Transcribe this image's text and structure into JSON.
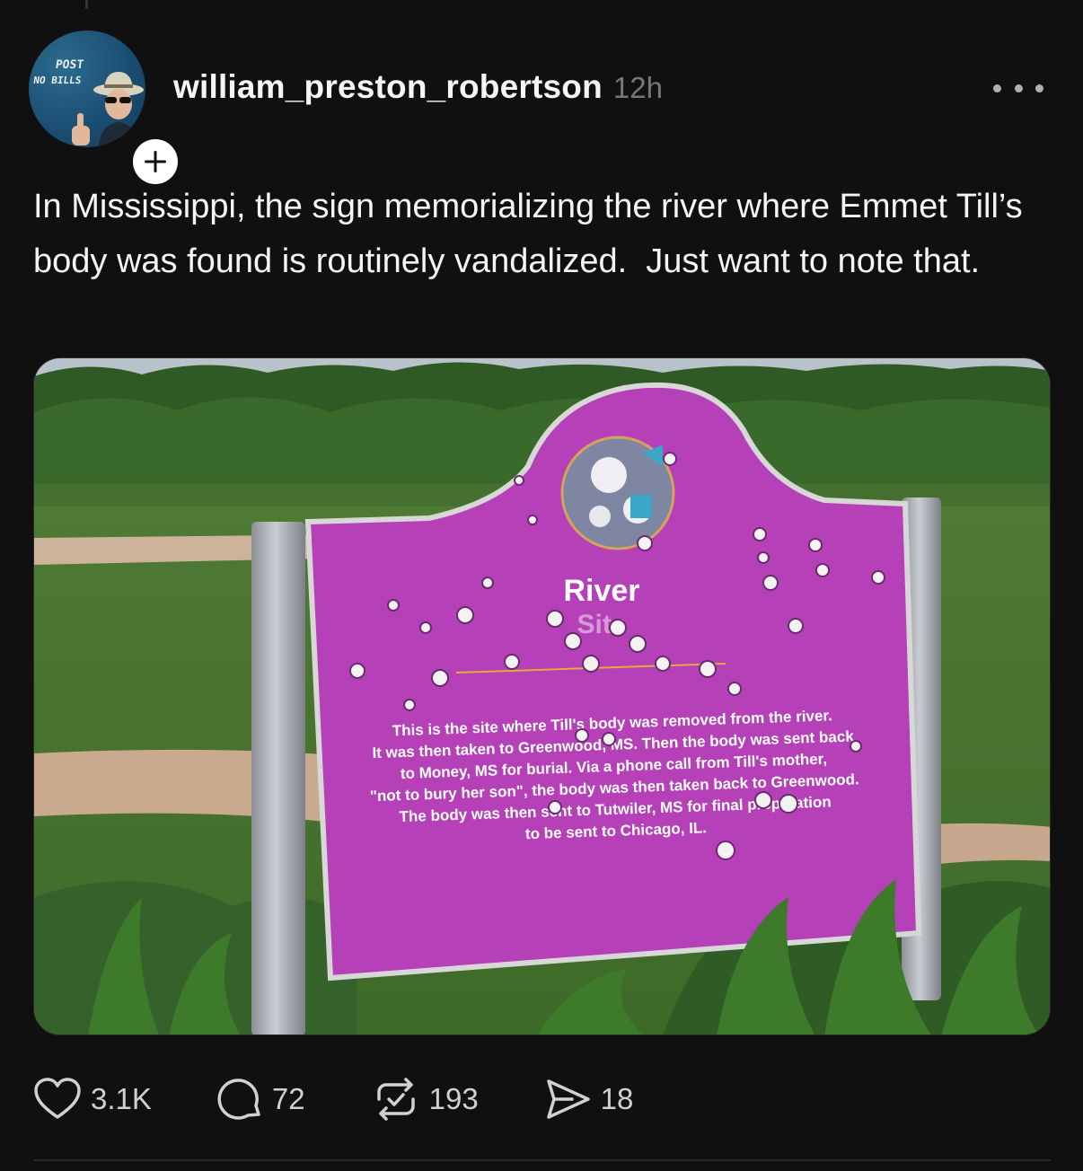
{
  "post": {
    "username": "william_preston_robertson",
    "time_ago": "12h",
    "text": "In Mississippi, the sign memorializing the river where Emmet Till’s body was found is routinely vandalized.  Just want to note that."
  },
  "avatar": {
    "wall_text_line1": "POST",
    "wall_text_line2": "NO BILLS"
  },
  "image": {
    "sign_title_line1": "River",
    "sign_title_line2": "Site",
    "sign_body": [
      "This is the site where Till's body was removed from the river.",
      "It was then taken to Greenwood, MS. Then the body was sent back",
      "to Money, MS for burial. Via a phone call from Till's mother,",
      "\"not to bury her son\", the body was then taken back to Greenwood.",
      "The body was then sent to Tutwiler, MS for final preparation",
      "to be sent to Chicago, IL."
    ],
    "sign_color": "#b540b8"
  },
  "actions": {
    "likes": "3.1K",
    "comments": "72",
    "reposts": "193",
    "shares": "18"
  },
  "icons": {
    "like": "heart-icon",
    "comment": "comment-bubble-icon",
    "repost": "repost-icon",
    "share": "send-icon",
    "more": "more-icon",
    "follow": "plus-icon"
  }
}
